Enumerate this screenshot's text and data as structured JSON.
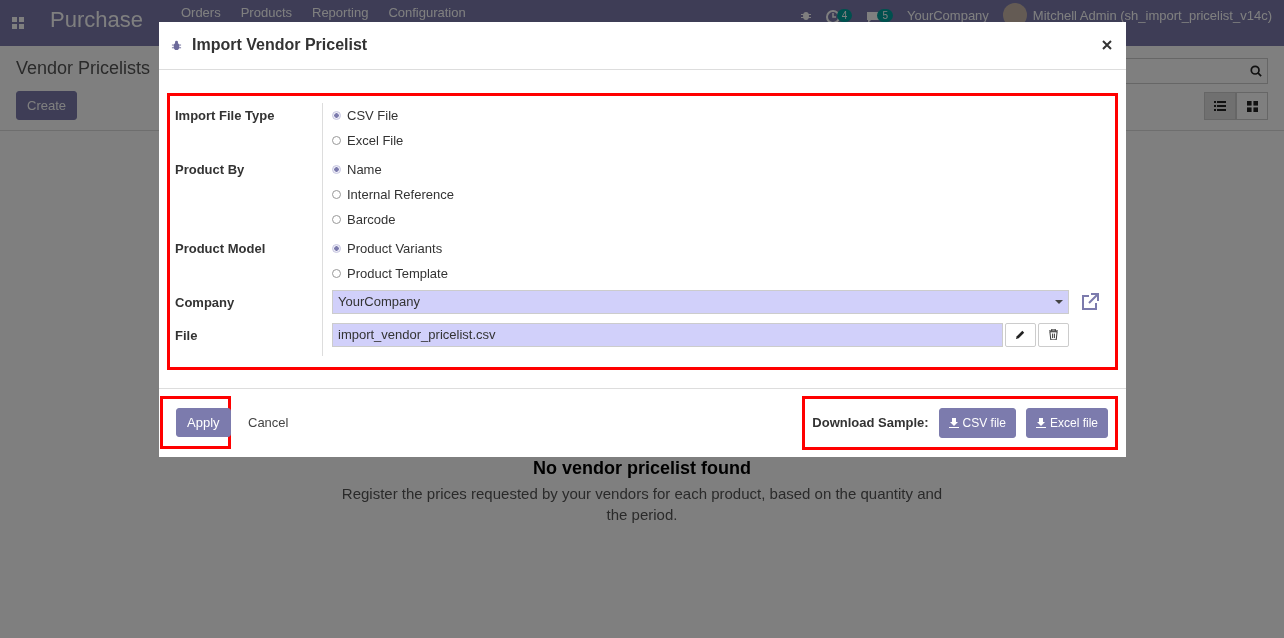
{
  "navbar": {
    "app_name": "Purchase",
    "menus": [
      "Orders",
      "Products",
      "Reporting",
      "Configuration"
    ],
    "activity_count": "4",
    "message_count": "5",
    "company": "YourCompany",
    "user": "Mitchell Admin (sh_import_pricelist_v14c)"
  },
  "control_panel": {
    "title": "Vendor Pricelists",
    "create_button": "Create",
    "views": [
      {
        "kind": "list",
        "selected": true
      },
      {
        "kind": "kanban",
        "selected": false
      }
    ]
  },
  "empty_state": {
    "title": "No vendor pricelist found",
    "text": "Register the prices requested by your vendors for each product, based on the quantity and the period."
  },
  "dialog": {
    "title": "Import Vendor Pricelist",
    "fields": [
      {
        "label": "Import File Type",
        "kind": "radio",
        "options": [
          {
            "label": "CSV File",
            "selected": true
          },
          {
            "label": "Excel File",
            "selected": false
          }
        ]
      },
      {
        "label": "Product By",
        "kind": "radio",
        "options": [
          {
            "label": "Name",
            "selected": true
          },
          {
            "label": "Internal Reference",
            "selected": false
          },
          {
            "label": "Barcode",
            "selected": false
          }
        ]
      },
      {
        "label": "Product Model",
        "kind": "radio",
        "options": [
          {
            "label": "Product Variants",
            "selected": true
          },
          {
            "label": "Product Template",
            "selected": false
          }
        ]
      },
      {
        "label": "Company",
        "kind": "select",
        "value": "YourCompany"
      },
      {
        "label": "File",
        "kind": "file",
        "value": "import_vendor_pricelist.csv"
      }
    ],
    "apply_button": "Apply",
    "cancel_button": "Cancel",
    "download_label": "Download Sample:",
    "download_buttons": [
      "CSV file",
      "Excel file"
    ]
  }
}
